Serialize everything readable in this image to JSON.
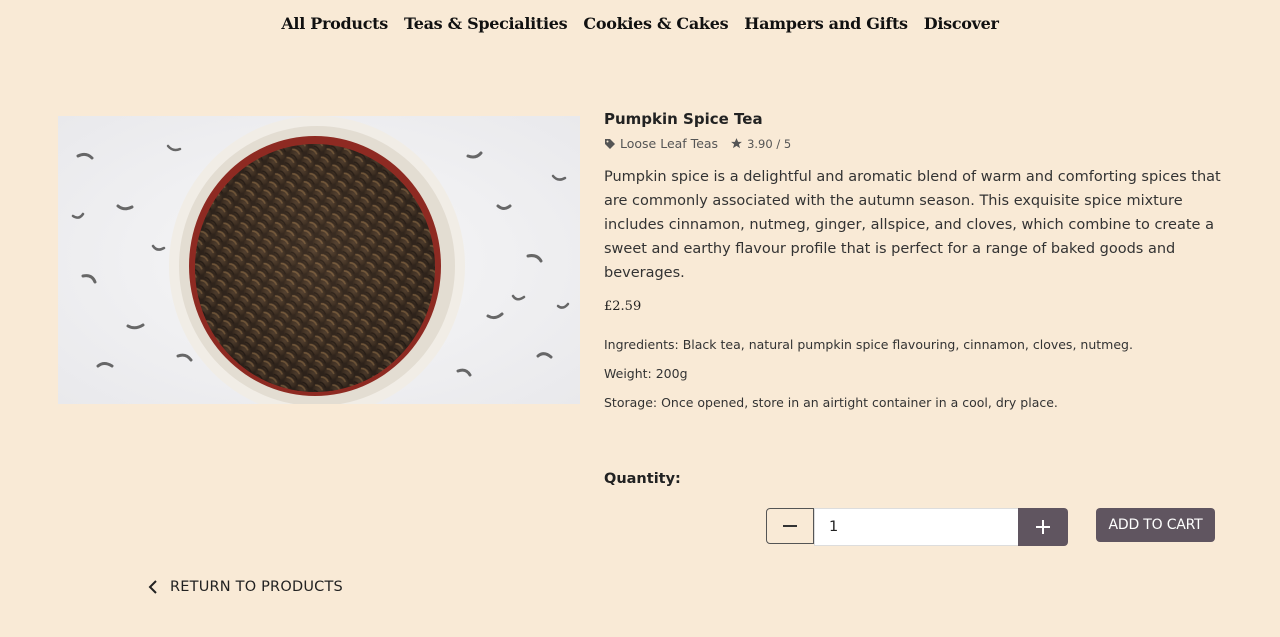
{
  "nav": {
    "items": [
      "All Products",
      "Teas & Specialities",
      "Cookies & Cakes",
      "Hampers and Gifts",
      "Discover"
    ]
  },
  "product": {
    "title": "Pumpkin Spice Tea",
    "category": "Loose Leaf Teas",
    "rating": "3.90 / 5",
    "description": "Pumpkin spice is a delightful and aromatic blend of warm and comforting spices that are commonly associated with the autumn season. This exquisite spice mixture includes cinnamon, nutmeg, ginger, allspice, and cloves, which combine to create a sweet and earthy flavour profile that is perfect for a range of baked goods and beverages.",
    "price": "£2.59",
    "ingredients": "Ingredients: Black tea, natural pumpkin spice flavouring, cinnamon, cloves, nutmeg.",
    "weight": "Weight: 200g",
    "storage": "Storage: Once opened, store in an airtight container in a cool, dry place."
  },
  "quantity": {
    "label": "Quantity:",
    "value": "1"
  },
  "actions": {
    "add_to_cart": "ADD TO CART",
    "return": "RETURN TO PRODUCTS"
  },
  "icons": {
    "category": "tag-icon",
    "rating": "star-icon",
    "minus": "minus-icon",
    "plus": "plus-icon",
    "return": "chevron-left-icon"
  },
  "colors": {
    "background": "#f9ead6",
    "button": "#605560"
  }
}
